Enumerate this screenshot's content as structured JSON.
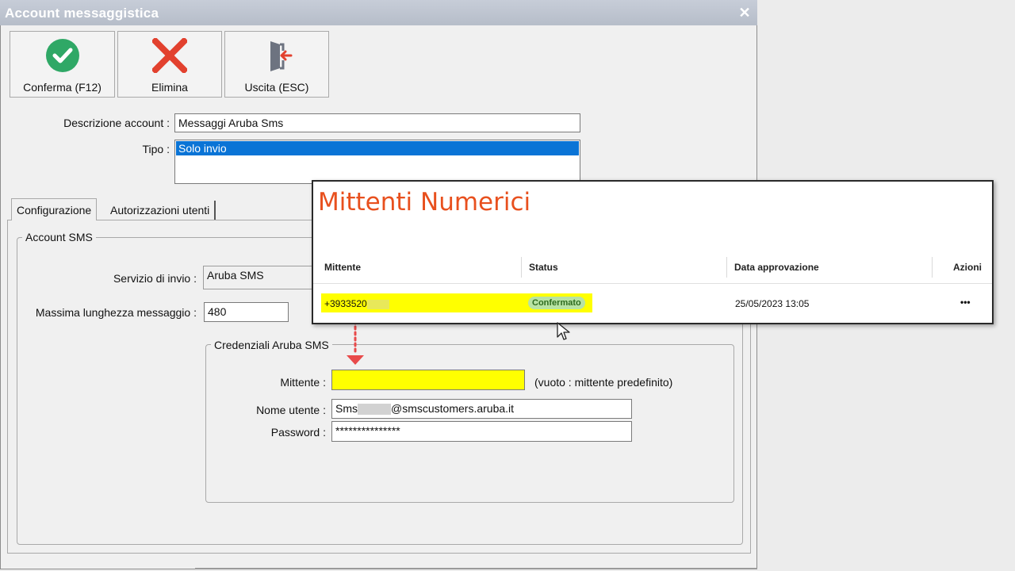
{
  "window": {
    "title": "Account messaggistica"
  },
  "toolbar": {
    "confirm_label": "Conferma (F12)",
    "delete_label": "Elimina",
    "exit_label": "Uscita (ESC)"
  },
  "form": {
    "description_label": "Descrizione account :",
    "description_value": "Messaggi Aruba Sms",
    "type_label": "Tipo :",
    "type_value": "Solo invio"
  },
  "tabs": [
    {
      "label": "Configurazione",
      "active": true
    },
    {
      "label": "Autorizzazioni utenti",
      "active": false
    }
  ],
  "account_sms": {
    "group_title": "Account SMS",
    "service_label": "Servizio di invio :",
    "service_value": "Aruba SMS",
    "max_length_label": "Massima lunghezza messaggio :",
    "max_length_value": "480"
  },
  "credentials": {
    "group_title": "Credenziali Aruba SMS",
    "sender_label": "Mittente :",
    "sender_value": "",
    "sender_hint": "(vuoto : mittente predefinito)",
    "username_label": "Nome utente :",
    "username_prefix": "Sms",
    "username_suffix": "@smscustomers.aruba.it",
    "password_label": "Password :",
    "password_value": "***************"
  },
  "overlay": {
    "title": "Mittenti Numerici",
    "columns": [
      "Mittente",
      "Status",
      "Data approvazione",
      "Azioni"
    ],
    "row": {
      "sender": "+3933520",
      "status": "Confermato",
      "approval_date": "25/05/2023 13:05",
      "actions": "•••"
    }
  },
  "colors": {
    "highlight": "#ffff00",
    "overlay_title": "#e8501e",
    "arrow": "#e84a4a",
    "confirm_icon": "#2fa866",
    "delete_icon": "#e2412e"
  }
}
